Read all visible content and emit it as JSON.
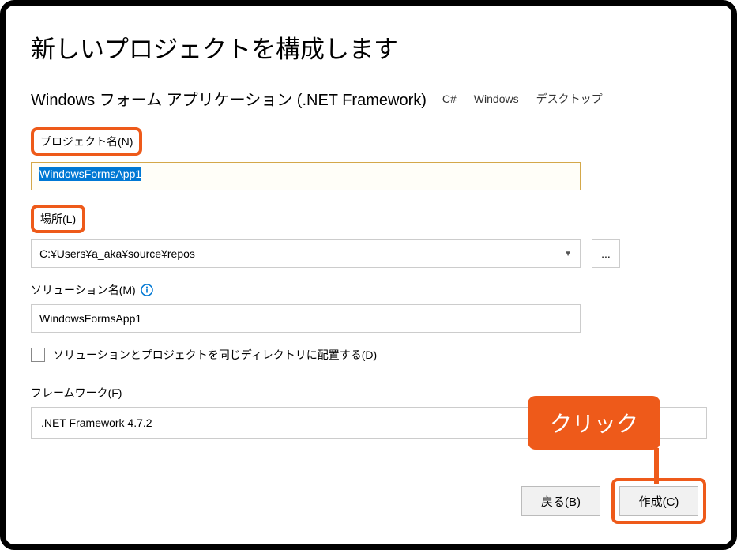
{
  "header": {
    "title": "新しいプロジェクトを構成します",
    "subtitle": "Windows フォーム アプリケーション (.NET Framework)",
    "tags": [
      "C#",
      "Windows",
      "デスクトップ"
    ]
  },
  "fields": {
    "projectName": {
      "label": "プロジェクト名(N)",
      "value": "WindowsFormsApp1"
    },
    "location": {
      "label": "場所(L)",
      "value": "C:¥Users¥a_aka¥source¥repos",
      "browseLabel": "..."
    },
    "solutionName": {
      "label": "ソリューション名(M)",
      "value": "WindowsFormsApp1"
    },
    "sameDirCheckbox": {
      "label": "ソリューションとプロジェクトを同じディレクトリに配置する(D)",
      "checked": false
    },
    "framework": {
      "label": "フレームワーク(F)",
      "value": ".NET Framework 4.7.2"
    }
  },
  "buttons": {
    "back": "戻る(B)",
    "create": "作成(C)"
  },
  "annotation": {
    "callout": "クリック"
  }
}
